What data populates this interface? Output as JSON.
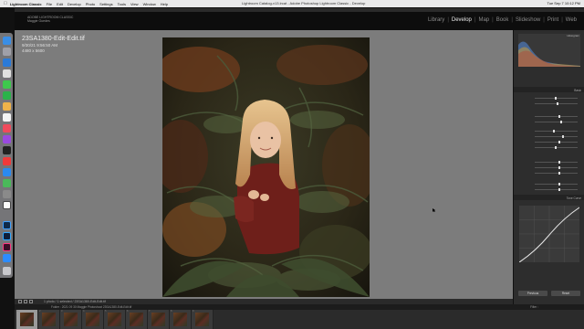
{
  "menubar": {
    "app_name": "Lightroom Classic",
    "items": [
      "File",
      "Edit",
      "Develop",
      "Photo",
      "Settings",
      "Tools",
      "View",
      "Window",
      "Help"
    ],
    "window_title": "Lightroom Catalog-v13.lrcat - Adobe Photoshop Lightroom Classic - Develop",
    "clock": "Tue Sep 7 10:12 PM"
  },
  "identity_plate": {
    "line1": "ADOBE LIGHTROOM CLASSIC",
    "line2": "Maggie Guedes"
  },
  "modules": {
    "items": [
      "Library",
      "Develop",
      "Map",
      "Book",
      "Slideshow",
      "Print",
      "Web"
    ],
    "active": "Develop"
  },
  "photo_info": {
    "filename": "23SA1380-Edit-Edit.tif",
    "datetime": "9/30/21 9:56:50 AM",
    "dimensions": "4480 x 5600"
  },
  "right_panel": {
    "histogram_label": "Histogram",
    "sections": [
      "Basic",
      "Tone Curve"
    ],
    "buttons": {
      "previous": "Previous",
      "reset": "Reset"
    }
  },
  "toolbar": {
    "info": "1 photo / 1 selected / 23SA1380-Edit-Edit.tif"
  },
  "filmstrip": {
    "header_path": "Folder : 2021 09 30 Maggie Photoshoot  23SA1380-Edit-Edit.tif",
    "filter_label": "Filter :",
    "thumbs": [
      "1",
      "2",
      "3",
      "4",
      "5",
      "6",
      "7",
      "8",
      "9"
    ],
    "selected_index": 0
  }
}
